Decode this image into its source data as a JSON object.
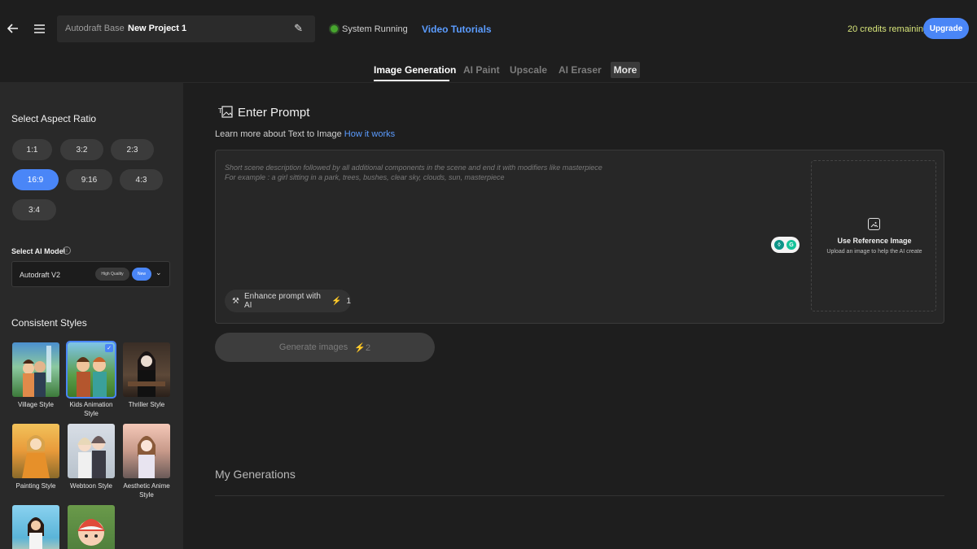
{
  "header": {
    "back_icon": "arrow-left-icon",
    "menu_icon": "hamburger-icon",
    "project_base": "Autodraft Base",
    "project_name": "New Project 1",
    "edit_icon": "pencil-icon",
    "status": "System Running",
    "status_color": "#47a62e",
    "video_tutorials": "Video Tutorials",
    "credits": "20 credits remaining",
    "upgrade": "Upgrade",
    "accent_color": "#4a86f7"
  },
  "tabs": [
    {
      "label": "Image Generation",
      "active": true
    },
    {
      "label": "AI Paint",
      "active": false
    },
    {
      "label": "Upscale",
      "active": false
    },
    {
      "label": "AI Eraser",
      "active": false
    },
    {
      "label": "More",
      "active": false
    }
  ],
  "sidebar": {
    "aspect_title": "Select Aspect Ratio",
    "aspect_ratios": [
      {
        "label": "1:1",
        "selected": false
      },
      {
        "label": "3:2",
        "selected": false
      },
      {
        "label": "2:3",
        "selected": false
      },
      {
        "label": "16:9",
        "selected": true
      },
      {
        "label": "9:16",
        "selected": false
      },
      {
        "label": "4:3",
        "selected": false
      },
      {
        "label": "3:4",
        "selected": false
      }
    ],
    "model_title": "Select AI Model",
    "model_name": "Autodraft V2",
    "model_badge_quality": "High Quality",
    "model_badge_new": "New",
    "styles_title": "Consistent Styles",
    "styles": [
      {
        "label": "Village Style",
        "selected": false
      },
      {
        "label": "Kids Animation Style",
        "selected": true
      },
      {
        "label": "Thriller Style",
        "selected": false
      },
      {
        "label": "Painting Style",
        "selected": false
      },
      {
        "label": "Webtoon Style",
        "selected": false
      },
      {
        "label": "Aesthetic Anime Style",
        "selected": false
      },
      {
        "label": "",
        "selected": false
      },
      {
        "label": "",
        "selected": false
      }
    ]
  },
  "main": {
    "prompt_title": "Enter Prompt",
    "learn_text": "Learn more about Text to Image ",
    "learn_link": "How it works",
    "placeholder_line1": "Short scene description followed by all additional components in the scene and end it with modifiers like masterpiece",
    "placeholder_line2": "For example : a girl sitting in a park, trees, bushes, clear sky, clouds, sun, masterpiece",
    "enhance_label": "Enhance prompt with AI",
    "enhance_cost": "1",
    "ref_title": "Use Reference Image",
    "ref_sub": "Upload an image to help the AI create",
    "generate_label": "Generate images",
    "generate_cost": "2",
    "my_generations": "My Generations"
  }
}
